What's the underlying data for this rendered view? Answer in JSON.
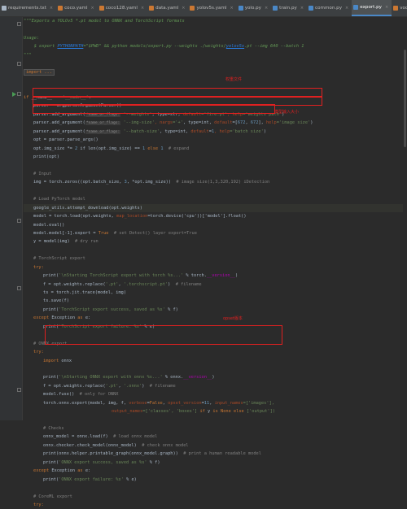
{
  "tabs": [
    {
      "label": "requirements.txt",
      "color": "#a9b7c6",
      "active": false
    },
    {
      "label": "coco.yaml",
      "color": "#cc7832",
      "active": false
    },
    {
      "label": "coco128.yaml",
      "color": "#cc7832",
      "active": false
    },
    {
      "label": "data.yaml",
      "color": "#cc7832",
      "active": false
    },
    {
      "label": "yolov5s.yaml",
      "color": "#cc7832",
      "active": false
    },
    {
      "label": "yolo.py",
      "color": "#4a88c7",
      "active": false
    },
    {
      "label": "train.py",
      "color": "#4a88c7",
      "active": false
    },
    {
      "label": "common.py",
      "color": "#4a88c7",
      "active": false
    },
    {
      "label": "export.py",
      "color": "#4a88c7",
      "active": true
    },
    {
      "label": "voc.yam",
      "color": "#cc7832",
      "active": false
    }
  ],
  "code": {
    "l1": "\"\"\"Exports a YOLOv5 *.pt model to ONNX and TorchScript formats",
    "l3": "Usage:",
    "l4a": "    $ export ",
    "l4b": "PYTHONPATH",
    "l4c": "=\"$PWD\" && python models/export.py --weights ./weights/",
    "l4d": "yolov5s",
    "l4e": ".pt --img 640 --batch 1",
    "l5": "\"\"\"",
    "l7": "import ...",
    "l10a": "if",
    "l10b": " __name__",
    "l10c": " == ",
    "l10d": "'__main__'",
    "l10e": ":",
    "l11": "parser = argparse.ArgumentParser()",
    "l12_pre": "parser.add_argument(",
    "l12_hint": "*name_or_flags:",
    "l12_s1": "'--weights'",
    "l12_mid": ", type=str, ",
    "l12_k1": "default",
    "l12_v1": "='fire.pt'",
    "l12_k2": ", help",
    "l12_v2": "='weights path'",
    "l12_end": ")",
    "l13_s1": "'--img-size'",
    "l13_k0": ", nargs",
    "l13_v0": "='+'",
    "l13_k1": ", type=int, ",
    "l13_k2": "default",
    "l13_v2": "=[",
    "l13_n1": "672",
    "l13_n2": "672",
    "l13_v3": "], ",
    "l13_k3": "help",
    "l13_v4": "='image size'",
    "l14_s1": "'--batch-size'",
    "l14_k1": ", type=int, ",
    "l14_k2": "default",
    "l14_n": "1",
    "l14_k3": ", help",
    "l14_v3": "='batch size'",
    "l15": "opt = parser.parse_args()",
    "l16a": "opt.img_size *= ",
    "l16b": "2",
    "l16c": " if len(opt.img_size) == ",
    "l16d": "1",
    "l16e": " else ",
    "l16f": "1",
    "l16g": "  # expand",
    "l17": "print(opt)",
    "l19": "# Input",
    "l20a": "img = torch.zeros((opt.batch_size, ",
    "l20b": "3",
    "l20c": ", *opt.img_size))  ",
    "l20d": "# image size(1,3,320,192) iDetection",
    "l22": "# Load PyTorch model",
    "l23": "google_utils.attempt_download(opt.weights)",
    "l24a": "model = torch.load(opt.weights, ",
    "l24b": "map_location",
    "l24c": "=torch.device('cpu'))['model'].float()",
    "l25": "model.eval()",
    "l26a": "model.model[-1].export = ",
    "l26b": "True",
    "l26c": "  # set Detect() layer export=True",
    "l27a": "y = model(img)  ",
    "l27b": "# dry run",
    "l29": "# TorchScript export",
    "l30": "try:",
    "l31a": "print(",
    "l31b": "'\\nStarting TorchScript export with torch %s...'",
    "l31c": " % torch.",
    "l31d": "__version__",
    "l31e": ")",
    "l32a": "f = opt.weights.replace(",
    "l32b": "'.pt'",
    "l32c": ", ",
    "l32d": "'.torchscript.pt'",
    "l32e": ")  ",
    "l32f": "# filename",
    "l33": "ts = torch.jit.trace(model, img)",
    "l34": "ts.save(f)",
    "l35a": "print(",
    "l35b": "'TorchScript export success, saved as %s'",
    "l35c": " % f)",
    "l36a": "except",
    "l36b": " Exception ",
    "l36c": "as",
    "l36d": " e:",
    "l37a": "print(",
    "l37b": "'TorchScript export failure: %s'",
    "l37c": " % e)",
    "l39": "# ONNX export",
    "l40": "try:",
    "l41a": "import",
    "l41b": " onnx",
    "l43a": "print(",
    "l43b": "'\\nStarting ONNX export with onnx %s...'",
    "l43c": " % onnx.",
    "l43d": "__version__",
    "l43e": ")",
    "l44a": "f = opt.weights.replace(",
    "l44b": "'.pt'",
    "l44c": ", ",
    "l44d": "'.onnx'",
    "l44e": ")  ",
    "l44f": "# filename",
    "l45a": "model.fuse()  ",
    "l45b": "# only for ONNX",
    "l46a": "torch.onnx.export(model, img, f, ",
    "l46b": "verbose",
    "l46c": "=",
    "l46d": "False",
    "l46e": ", ",
    "l46f": "opset_version",
    "l46g": "=",
    "l46h": "11",
    "l46i": ", ",
    "l46j": "input_names",
    "l46k": "=['images'],",
    "l47a": "output_names",
    "l47b": "=['classes', 'boxes'] ",
    "l47c": "if",
    "l47d": " y ",
    "l47e": "is",
    "l47f": " None ",
    "l47g": "else",
    "l47h": " ['output'])",
    "l49": "# Checks",
    "l50a": "onnx_model = onnx.load(f)  ",
    "l50b": "# load onnx model",
    "l51a": "onnx.checker.check_model(onnx_model)  ",
    "l51b": "# check onnx model",
    "l52a": "print(onnx.helper.printable_graph(onnx_model.graph))  ",
    "l52b": "# print a human readable model",
    "l53a": "print(",
    "l53b": "'ONNX export success, saved as %s'",
    "l53c": " % f)",
    "l54a": "except",
    "l54b": " Exception ",
    "l54c": "as",
    "l54d": " e:",
    "l55a": "print(",
    "l55b": "'ONNX export failure: %s'",
    "l55c": " % e)",
    "l57": "# CoreML export",
    "l58": "try:"
  },
  "annotations": {
    "weights_note": "权重文件",
    "size_note": "模型输入大小",
    "opset_note": "opset版本"
  }
}
